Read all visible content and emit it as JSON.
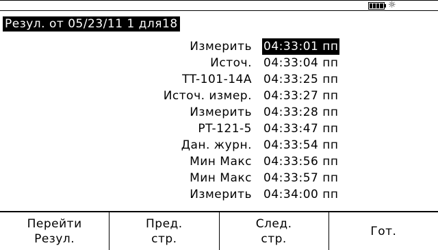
{
  "status": {
    "battery_icon": "battery-full-icon",
    "backlight_icon": "backlight-icon"
  },
  "title": "Резул. от 05/23/11 1 для18",
  "results": [
    {
      "label": "Измерить",
      "time": "04:33:01 пп"
    },
    {
      "label": "Источ.",
      "time": "04:33:04 пп"
    },
    {
      "label": "TT-101-14A",
      "time": "04:33:25 пп"
    },
    {
      "label": "Источ. измер.",
      "time": "04:33:27 пп"
    },
    {
      "label": "Измерить",
      "time": "04:33:28 пп"
    },
    {
      "label": "PT-121-5",
      "time": "04:33:47 пп"
    },
    {
      "label": "Дан. журн.",
      "time": "04:33:54 пп"
    },
    {
      "label": "Мин Макс",
      "time": "04:33:56 пп"
    },
    {
      "label": "Мин Макс",
      "time": "04:33:57 пп"
    },
    {
      "label": "Измерить",
      "time": "04:34:00 пп"
    }
  ],
  "softkeys": [
    {
      "line1": "Перейти",
      "line2": "Резул."
    },
    {
      "line1": "Пред.",
      "line2": "стр."
    },
    {
      "line1": "След.",
      "line2": "стр."
    },
    {
      "line1": "Гот.",
      "line2": ""
    }
  ]
}
